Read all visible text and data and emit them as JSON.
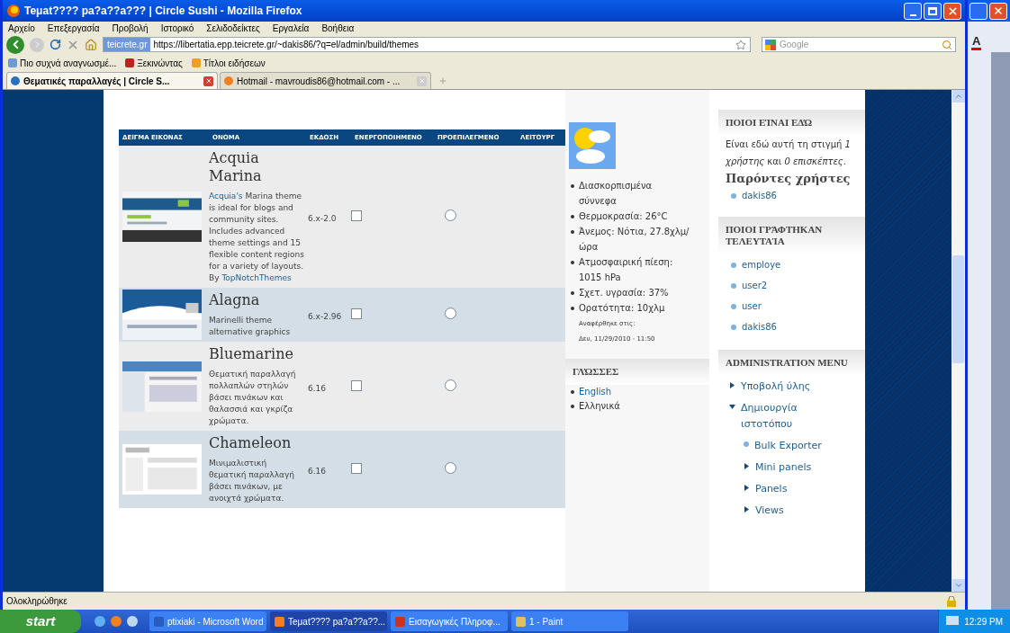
{
  "window": {
    "title": "Teμat???? pa?a??a??? | Circle Sushi - Mozilla Firefox"
  },
  "menu": [
    "Αρχείο",
    "Επεξεργασία",
    "Προβολή",
    "Ιστορικό",
    "Σελιδοδείκτες",
    "Εργαλεία",
    "Βοήθεια"
  ],
  "address": {
    "site": "teicrete.gr",
    "url": "https://libertatia.epp.teicrete.gr/~dakis86/?q=el/admin/build/themes"
  },
  "search": {
    "placeholder": "Google"
  },
  "bookmarks": [
    "Πιο συχνά αναγνωσμέ...",
    "Ξεκινώντας",
    "Τίτλοι ειδήσεων"
  ],
  "tabs": [
    {
      "label": "Θεματικές παραλλαγές | Circle S...",
      "selected": true
    },
    {
      "label": "Hotmail - mavroudis86@hotmail.com - ...",
      "selected": false
    }
  ],
  "table": {
    "columns": [
      "ΔΕΙΓΜΑ ΕΙΚΟΝΑΣ",
      "ΟΝΟΜΑ",
      "ΕΚΔΟΣΗ",
      "ΕΝΕΡΓΟΠΟΙΗΜΕΝΟ",
      "ΠΡΟΕΠΙΛΕΓΜΕΝΟ",
      "ΛΕΙΤΟΥΡΓ"
    ],
    "rows": [
      {
        "name": "Acquia Marina",
        "description": [
          {
            "text": "Acquia's",
            "link": true
          },
          {
            "text": " Marina theme is ideal for blogs and community sites. Includes advanced theme settings and 15 flexible content regions for a variety of layouts. By ",
            "link": false
          },
          {
            "text": "TopNotchThemes",
            "link": true
          }
        ],
        "version": "6.x-2.0",
        "enabled": false,
        "default": false
      },
      {
        "name": "Alagna",
        "description": [
          {
            "text": "Marinelli theme alternative graphics",
            "link": false
          }
        ],
        "version": "6.x-2.96",
        "enabled": false,
        "default": false
      },
      {
        "name": "Bluemarine",
        "description": [
          {
            "text": "Θεματική παραλλαγή πολλαπλών στηλών βάσει πινάκων και θαλασσιά και γκρίζα χρώματα.",
            "link": false
          }
        ],
        "version": "6.16",
        "enabled": false,
        "default": false
      },
      {
        "name": "Chameleon",
        "description": [
          {
            "text": "Μινιμαλιστική θεματική παραλλαγή βάσει πινάκων, με ανοιχτά χρώματα.",
            "link": false
          }
        ],
        "version": "6.16",
        "enabled": false,
        "default": false
      }
    ]
  },
  "weather": {
    "conditions": [
      "Διασκορπισμένα σύννεφα",
      "Θερμοκρασία: 26°C",
      "Άνεμος: Νότια, 27.8χλμ/ώρα",
      "Ατμοσφαιρική πίεση: 1015 hPa",
      "Σχετ. υγρασία: 37%",
      "Ορατότητα: 10χλμ"
    ],
    "reported_label": "Αναφέρθηκε στις:",
    "reported_time": "Δευ, 11/29/2010 - 11:50"
  },
  "languages": {
    "title": "ΓΛΏΣΣΕΣ",
    "items": [
      {
        "label": "English",
        "link": true
      },
      {
        "label": "Ελληνικά",
        "link": false
      }
    ]
  },
  "who_is_online": {
    "title": "ΠΟΙΟΙ ΕΊΝΑΙ ΕΔΏ",
    "text": "Είναι εδώ αυτή τη στιγμή *1 χρήστης* και *0 επισκέπτες*.",
    "subtitle": "Παρόντες χρήστες",
    "users": [
      "dakis86"
    ]
  },
  "who_is_new": {
    "title": "ΠΟΙΟΙ ΓΡΆΦΤΗΚΑΝ ΤΕΛΕΥΤΑΊΑ",
    "users": [
      "employe",
      "user2",
      "user",
      "dakis86"
    ]
  },
  "admin_menu": {
    "title": "ADMINISTRATION MENU",
    "items": [
      {
        "label": "Υποβολή ύλης",
        "kind": "branch",
        "expanded": false
      },
      {
        "label": "Δημιουργία ιστοτόπου",
        "kind": "branch",
        "expanded": true,
        "children": [
          {
            "label": "Bulk Exporter",
            "kind": "leaf"
          },
          {
            "label": "Mini panels",
            "kind": "branch",
            "expanded": false
          },
          {
            "label": "Panels",
            "kind": "branch",
            "expanded": false
          },
          {
            "label": "Views",
            "kind": "branch",
            "expanded": false
          }
        ]
      }
    ]
  },
  "status_bar": "Ολοκληρώθηκε",
  "word_window": {
    "font_color_label": "A"
  },
  "taskbar": {
    "start": "start",
    "tasks": [
      {
        "label": "ptixiaki - Microsoft Word",
        "selected": false
      },
      {
        "label": "Teμat???? pa?a??a??...",
        "selected": true
      },
      {
        "label": "Εισαγωγικές Πληροφ...",
        "selected": false
      },
      {
        "label": "1 - Paint",
        "selected": false
      }
    ],
    "clock": "12:29 PM"
  }
}
